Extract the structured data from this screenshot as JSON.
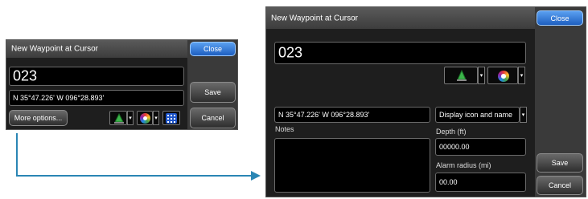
{
  "small_dialog": {
    "title": "New Waypoint at Cursor",
    "close_label": "Close",
    "name_value": "023",
    "coordinates": "N 35°47.226'   W 096°28.893'",
    "more_options_label": "More options...",
    "save_label": "Save",
    "cancel_label": "Cancel",
    "dropdown_arrow": "▾"
  },
  "large_dialog": {
    "title": "New Waypoint at Cursor",
    "close_label": "Close",
    "name_value": "023",
    "coordinates": "N 35°47.226'   W 096°28.893'",
    "display_option": "Display icon and name",
    "notes_label": "Notes",
    "depth_label": "Depth (ft)",
    "depth_value": "00000.00",
    "alarm_label": "Alarm radius (mi)",
    "alarm_value": "00.00",
    "save_label": "Save",
    "cancel_label": "Cancel",
    "dropdown_arrow": "▾"
  },
  "colors": {
    "arrow": "#2a86b4",
    "close_button": "#3a7fe0"
  },
  "icons": {
    "waypoint_symbol": "waypoint-symbol-icon",
    "color_picker": "color-wheel-icon",
    "grid": "grid-icon"
  }
}
